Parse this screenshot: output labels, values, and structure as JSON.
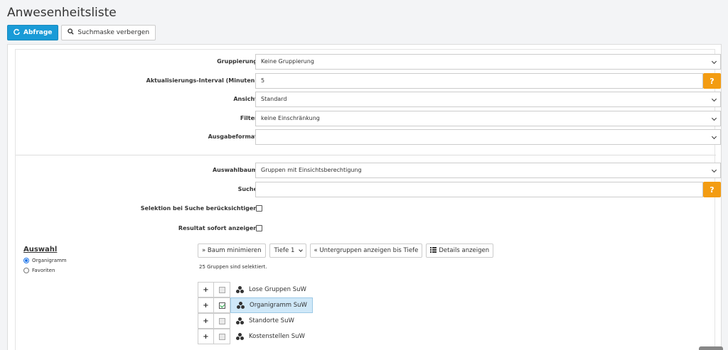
{
  "page": {
    "title": "Anwesenheitsliste"
  },
  "toolbar": {
    "query_label": "Abfrage",
    "toggle_search_label": "Suchmaske verbergen"
  },
  "form": {
    "gruppierung": {
      "label": "Gruppierung",
      "value": "Keine Gruppierung"
    },
    "interval": {
      "label": "Aktualisierungs-Interval (Minuten)",
      "value": "5",
      "help": "?"
    },
    "ansicht": {
      "label": "Ansicht",
      "value": "Standard"
    },
    "filter": {
      "label": "Filter",
      "value": "keine Einschränkung"
    },
    "ausgabeformat": {
      "label": "Ausgabeformat",
      "value": ""
    },
    "auswahlbaum": {
      "label": "Auswahlbaum",
      "value": "Gruppen mit Einsichtsberechtigung"
    },
    "suche": {
      "label": "Suche",
      "value": "",
      "help": "?"
    },
    "selektion": {
      "label": "Selektion bei Suche berücksichtigen"
    },
    "resultat": {
      "label": "Resultat sofort anzeigen"
    }
  },
  "auswahl": {
    "title": "Auswahl",
    "options": [
      {
        "label": "Organigramm",
        "selected": true
      },
      {
        "label": "Favoriten",
        "selected": false
      }
    ]
  },
  "tree_tools": {
    "minimize_label": "» Baum minimieren",
    "depth_value": "Tiefe 1",
    "subgroups_label": "« Untergruppen anzeigen bis Tiefe",
    "details_label": "Details anzeigen"
  },
  "tree": {
    "status": "25 Gruppen sind selektiert.",
    "nodes": [
      {
        "label": "Lose Gruppen SuW",
        "checked": false,
        "selected": false
      },
      {
        "label": "Organigramm SuW",
        "checked": true,
        "selected": true
      },
      {
        "label": "Standorte SuW",
        "checked": false,
        "selected": false
      },
      {
        "label": "Kostenstellen SuW",
        "checked": false,
        "selected": false
      }
    ]
  },
  "colors": {
    "primary": "#1a9bd7",
    "help": "#f39c12",
    "selected_row": "#cfe8f8",
    "check": "#1a9f3a"
  }
}
